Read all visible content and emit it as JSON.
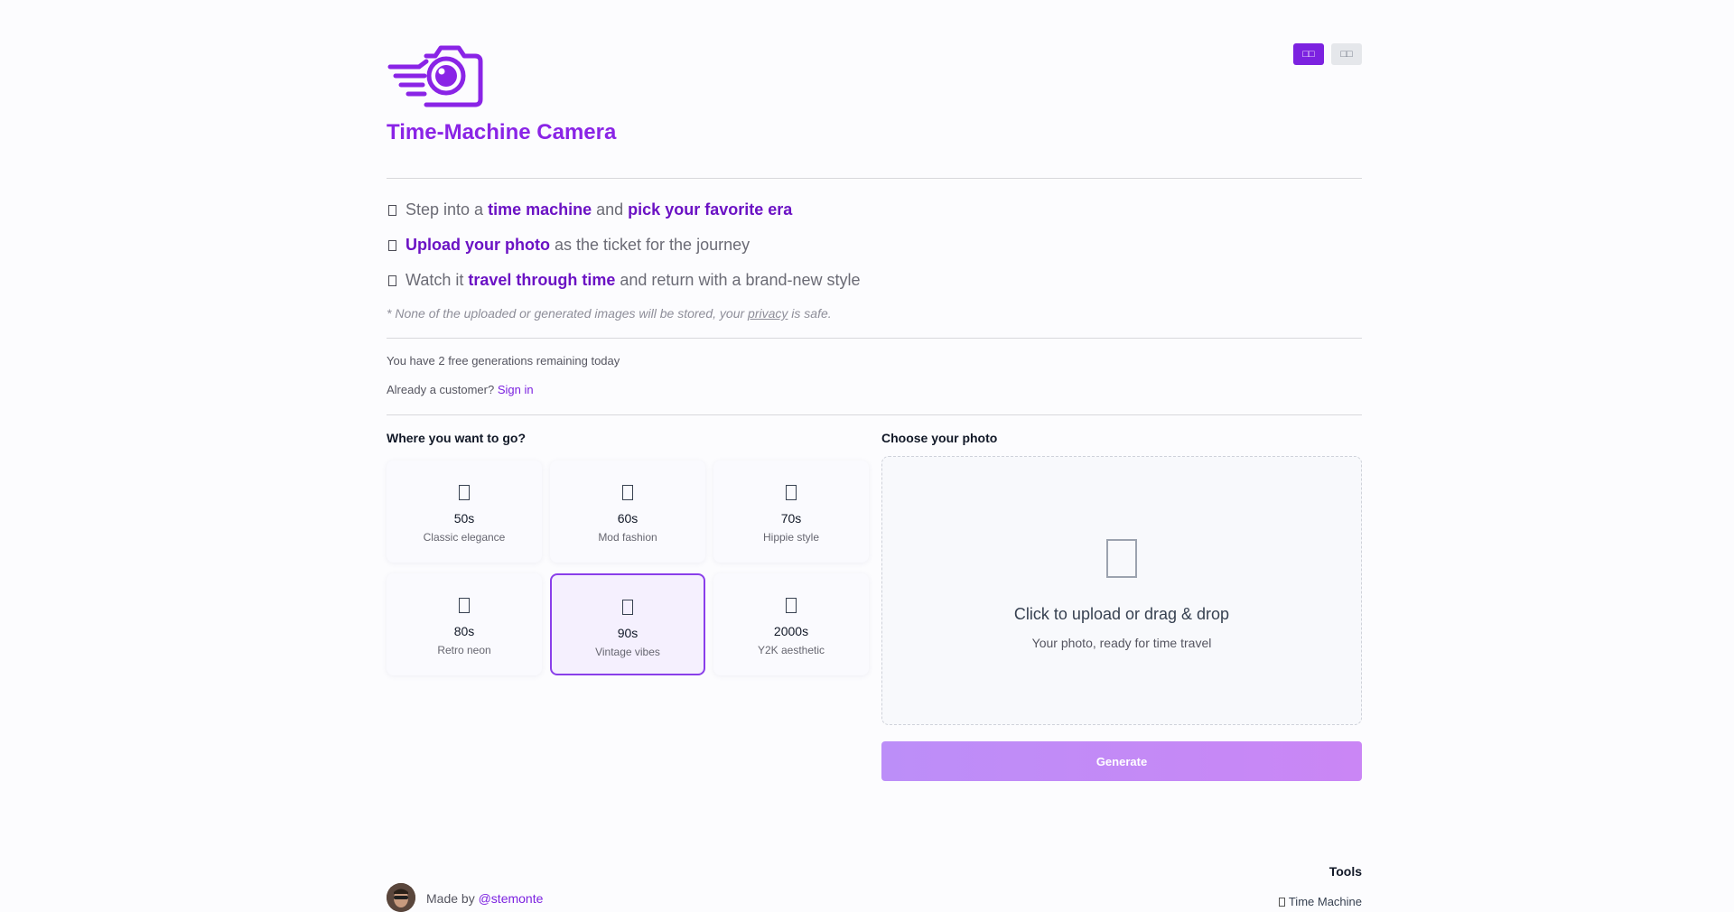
{
  "header": {
    "title": "Time-Machine Camera",
    "language_buttons": [
      {
        "label": "□□",
        "active": true
      },
      {
        "label": "□□",
        "active": false
      }
    ]
  },
  "features": [
    {
      "parts": [
        {
          "text": "Step into a ",
          "strong": false
        },
        {
          "text": "time machine",
          "strong": true
        },
        {
          "text": " and ",
          "strong": false
        },
        {
          "text": "pick your favorite era",
          "strong": true
        }
      ]
    },
    {
      "parts": [
        {
          "text": "Upload your photo",
          "strong": true
        },
        {
          "text": " as the ticket for the journey",
          "strong": false
        }
      ]
    },
    {
      "parts": [
        {
          "text": "Watch it ",
          "strong": false
        },
        {
          "text": "travel through time",
          "strong": true
        },
        {
          "text": " and return with a brand-new style",
          "strong": false
        }
      ]
    }
  ],
  "privacy": {
    "prefix": "* None of the uploaded or generated images will be stored, your ",
    "link": "privacy",
    "suffix": " is safe."
  },
  "account": {
    "remaining": "You have 2 free generations remaining today",
    "customer_prompt": "Already a customer?",
    "sign_in": "Sign in"
  },
  "eras": {
    "label": "Where you want to go?",
    "selected_index": 4,
    "items": [
      {
        "name": "50s",
        "desc": "Classic elegance"
      },
      {
        "name": "60s",
        "desc": "Mod fashion"
      },
      {
        "name": "70s",
        "desc": "Hippie style"
      },
      {
        "name": "80s",
        "desc": "Retro neon"
      },
      {
        "name": "90s",
        "desc": "Vintage vibes"
      },
      {
        "name": "2000s",
        "desc": "Y2K aesthetic"
      }
    ]
  },
  "upload": {
    "label": "Choose your photo",
    "title": "Click to upload or drag & drop",
    "subtitle": "Your photo, ready for time travel"
  },
  "generate_label": "Generate",
  "footer": {
    "made_by": "Made by",
    "author": "@stemonte",
    "tools_heading": "Tools",
    "tools_link": "Time Machine"
  },
  "colors": {
    "accent": "#7c22e0",
    "title": "#8a24e6",
    "emphasis": "#6b12c4"
  }
}
